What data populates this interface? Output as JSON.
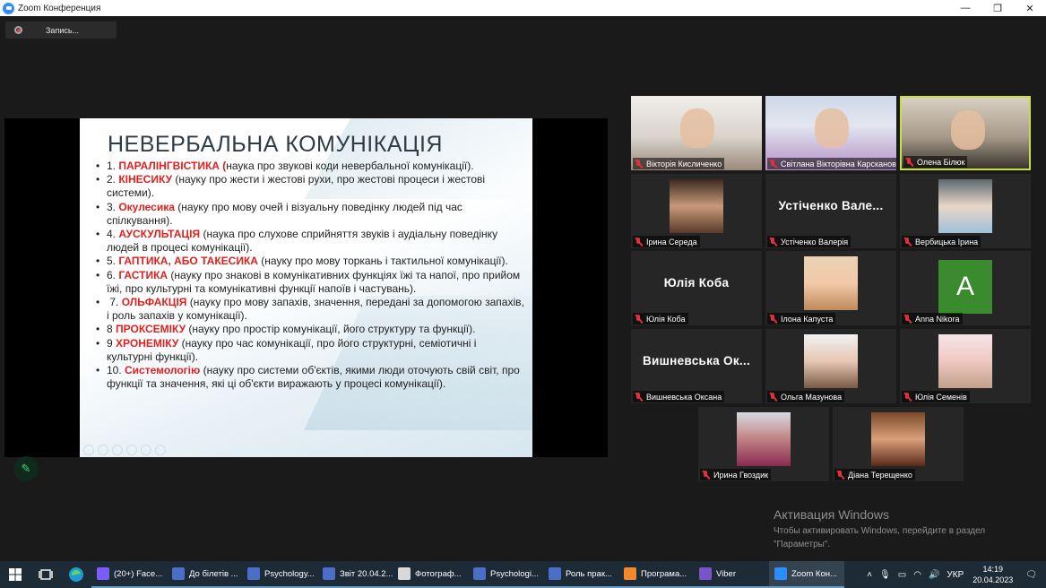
{
  "window": {
    "title": "Zoom Конференция",
    "minimize": "—",
    "restore": "❐",
    "close": "✕"
  },
  "recording": {
    "label": "Запись..."
  },
  "slide": {
    "title": "НЕВЕРБАЛЬНА КОМУНІКАЦІЯ",
    "items": [
      {
        "pre": "1. ",
        "hl": "ПАРАЛІНГВІСТИКА (",
        "text": "наука про звукові коди невербальної комунікації)."
      },
      {
        "pre": "2. ",
        "hl": "КІНЕСИКУ ",
        "text": "(науку про жести і жестові рухи, про жестові процеси і жестові системи)."
      },
      {
        "pre": "3. ",
        "hl": "Окулесика ",
        "text": "(науку про мову очей і візуальну поведінку людей під час спілкування)."
      },
      {
        "pre": "4. ",
        "hl": "АУСКУЛЬТАЦІЯ ",
        "text": "(наука про слухове сприйняття звуків і аудіальну поведінку людей в процесі комунікації)."
      },
      {
        "pre": "5. ",
        "hl": "ГАПТИКА, АБО ТАКЕСИКА ",
        "text": "(науку про мову торкань і тактильної комунікації)."
      },
      {
        "pre": "6. ",
        "hl": "ГАСТИКА ",
        "text": "(науку про знакові в комунікативних функціях їжі та напої, про прийом їжі, про культурні та комунікативні функції напоїв і частувань)."
      },
      {
        "pre": " 7. ",
        "hl": "ОЛЬФАКЦІЯ ",
        "text": "(науку про мову запахів, значення, передані за допомогою запахів, і роль запахів у комунікації)."
      },
      {
        "pre": "8  ",
        "hl": "ПРОКСЕМІКУ ",
        "text": "(науку про простір комунікації, його структуру та функції)."
      },
      {
        "pre": "9  ",
        "hl": "ХРОНЕМІКУ ",
        "text": "(науку про час комунікації, про його структурні, семіотичні і культурні функції)."
      },
      {
        "pre": "10. ",
        "hl": "Системологію ",
        "text": "(науку про системи об'єктів, якими люди оточують свій світ, про функції та значення, які ці об'єкти виражають у процесі комунікації)."
      }
    ]
  },
  "participants": [
    {
      "name": "Вікторія Кисличенко",
      "kind": "video"
    },
    {
      "name": "Світлана Вікторівна Карсканова",
      "kind": "video"
    },
    {
      "name": "Олена Білюк",
      "kind": "video",
      "active": true
    },
    {
      "name": "Ірина Середа",
      "kind": "video"
    },
    {
      "name": "Устіченко Валерія",
      "kind": "text",
      "display": "Устіченко  Вале..."
    },
    {
      "name": "Вербицька Ірина",
      "kind": "video"
    },
    {
      "name": "Юлія Коба",
      "kind": "text",
      "display": "Юлія  Коба"
    },
    {
      "name": "Ілона Капуста",
      "kind": "video"
    },
    {
      "name": "Anna Nikora",
      "kind": "avatar",
      "letter": "A",
      "avatar_color": "#3a8a2e"
    },
    {
      "name": "Вишневська Оксана",
      "kind": "text",
      "display": "Вишневська  Ок..."
    },
    {
      "name": "Ольга Мазунова",
      "kind": "video"
    },
    {
      "name": "Юлія Семенів",
      "kind": "video"
    },
    {
      "name": "Ирина Гвоздик",
      "kind": "video"
    },
    {
      "name": "Діана Терещенко",
      "kind": "video"
    }
  ],
  "activation": {
    "title": "Активация Windows",
    "line1": "Чтобы активировать Windows, перейдите в раздел",
    "line2": "\"Параметры\"."
  },
  "taskbar": {
    "apps": [
      {
        "label": "(20+) Face...",
        "color": "#7a5cff"
      },
      {
        "label": "До білетів ...",
        "color": "#4b6fc9"
      },
      {
        "label": "Psychology...",
        "color": "#4b6fc9"
      },
      {
        "label": "Звіт 20.04.2...",
        "color": "#4b6fc9"
      },
      {
        "label": "Фотограф...",
        "color": "#d8d8d8"
      },
      {
        "label": "Psychologi...",
        "color": "#4b6fc9"
      },
      {
        "label": "Роль прак...",
        "color": "#4b6fc9"
      },
      {
        "label": "Програма...",
        "color": "#f4862b"
      },
      {
        "label": "Viber",
        "color": "#7b53c9"
      },
      {
        "label": "Zoom Кон...",
        "color": "#2d8cff",
        "active": true
      }
    ],
    "lang": "УКР",
    "time": "14:19",
    "date": "20.04.2023"
  }
}
